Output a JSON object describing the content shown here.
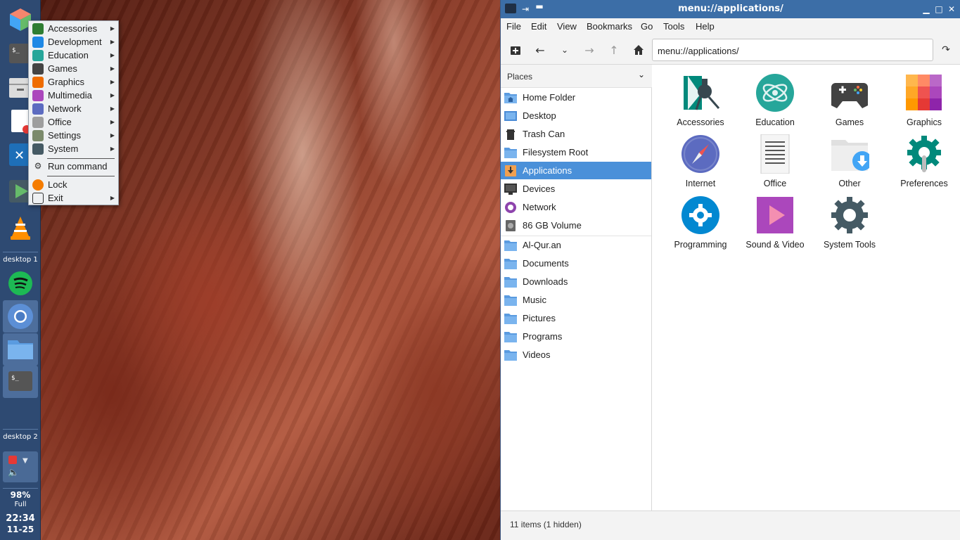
{
  "dock": {
    "workspace_labels": [
      "desktop 1",
      "desktop 2"
    ],
    "battery": {
      "percent": "98%",
      "status": "Full"
    },
    "clock": {
      "time": "22:34",
      "date": "11-25"
    }
  },
  "app_menu": {
    "items": [
      {
        "label": "Accessories",
        "color": "#2e7d32"
      },
      {
        "label": "Development",
        "color": "#1e88e5"
      },
      {
        "label": "Education",
        "color": "#26a69a"
      },
      {
        "label": "Games",
        "color": "#444444"
      },
      {
        "label": "Graphics",
        "color": "#ef6c00"
      },
      {
        "label": "Multimedia",
        "color": "#ab47bc"
      },
      {
        "label": "Network",
        "color": "#5c6bc0"
      },
      {
        "label": "Office",
        "color": "#9e9e9e"
      },
      {
        "label": "Settings",
        "color": "#7b8a6b"
      },
      {
        "label": "System",
        "color": "#455a64"
      }
    ],
    "run_command": "Run command",
    "lock": "Lock",
    "exit": "Exit"
  },
  "file_manager": {
    "title": "menu://applications/",
    "menubar": [
      "File",
      "Edit",
      "View",
      "Bookmarks",
      "Go",
      "Tools",
      "Help"
    ],
    "path": "menu://applications/",
    "sidebar": {
      "header": "Places",
      "places": [
        {
          "label": "Home Folder",
          "icon": "home-folder-icon"
        },
        {
          "label": "Desktop",
          "icon": "desktop-icon"
        },
        {
          "label": "Trash Can",
          "icon": "trash-icon"
        },
        {
          "label": "Filesystem Root",
          "icon": "folder-icon"
        },
        {
          "label": "Applications",
          "icon": "applications-icon",
          "selected": true
        },
        {
          "label": "Devices",
          "icon": "monitor-icon"
        },
        {
          "label": "Network",
          "icon": "network-icon"
        },
        {
          "label": "86 GB Volume",
          "icon": "drive-icon"
        }
      ],
      "bookmarks": [
        "Al-Qur.an",
        "Documents",
        "Downloads",
        "Music",
        "Pictures",
        "Programs",
        "Videos"
      ]
    },
    "items": [
      {
        "label": "Accessories",
        "icon": "accessories-icon"
      },
      {
        "label": "Education",
        "icon": "education-icon"
      },
      {
        "label": "Games",
        "icon": "games-icon"
      },
      {
        "label": "Graphics",
        "icon": "graphics-icon"
      },
      {
        "label": "Internet",
        "icon": "internet-icon"
      },
      {
        "label": "Office",
        "icon": "office-icon"
      },
      {
        "label": "Other",
        "icon": "other-icon"
      },
      {
        "label": "Preferences",
        "icon": "preferences-icon"
      },
      {
        "label": "Programming",
        "icon": "programming-icon"
      },
      {
        "label": "Sound & Video",
        "icon": "sound-video-icon"
      },
      {
        "label": "System Tools",
        "icon": "system-tools-icon"
      }
    ],
    "status": "11 items (1 hidden)",
    "colors": {
      "titlebar": "#3c6ea7",
      "selection": "#4a90d9",
      "folder": "#5a9be0"
    }
  }
}
